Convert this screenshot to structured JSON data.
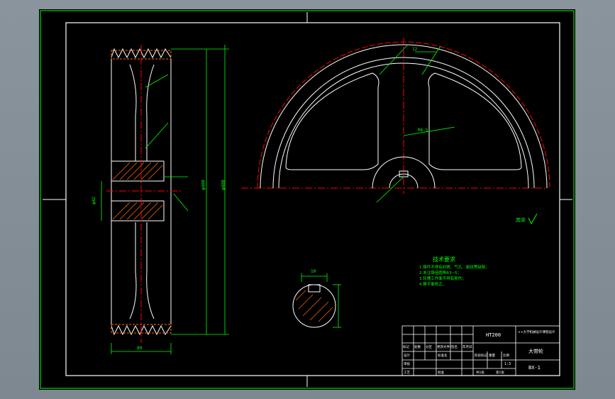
{
  "drawing": {
    "title": "大带轮",
    "drawing_number": "BX-1",
    "material": "HT200",
    "scale": "1:3",
    "roughness_label": "其余",
    "tech_req_title": "技术要求",
    "tech_req_items": [
      "1.铸件不得有砂眼、气孔、裂纹等缺陷；",
      "2.未注铸造圆角R3~5；",
      "3.轮槽工作面不得有损伤；",
      "4.静平衡校正。"
    ],
    "dims": {
      "keyway": "10",
      "outer_diameter": "φ488",
      "pitch_diameter": "φ480",
      "hub_width": "80",
      "bore": "φ42",
      "spoke_width": "R6.5",
      "rim_thickness": "12"
    },
    "title_block": {
      "col_headers": [
        "标记",
        "处数",
        "分区",
        "更改文件号",
        "签名",
        "年月日"
      ],
      "stage_labels": [
        "阶段标记",
        "重量",
        "比例"
      ],
      "sheet_info": [
        "共1张",
        "第1张"
      ],
      "roles": [
        "设计",
        "审核",
        "工艺",
        "批准",
        "标准化"
      ],
      "project_code": "××大学机械设计课程设计"
    }
  },
  "colors": {
    "background": "#000000",
    "border": "#00ff00",
    "geometry": "#ffffff",
    "centerline": "#ff0000",
    "dimension": "#00ff00",
    "hatch": "#ff6a00"
  }
}
